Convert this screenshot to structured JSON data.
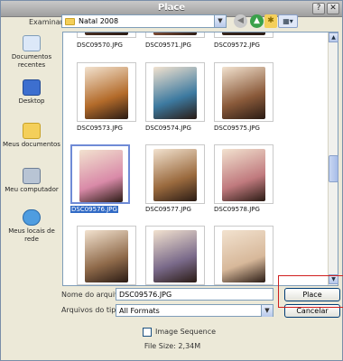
{
  "window": {
    "title": "Place"
  },
  "toolbar": {
    "lookin_label": "Examinar:",
    "lookin_value": "Natal 2008",
    "back_icon": "back-arrow-icon",
    "up_icon": "up-folder-icon",
    "newfolder_icon": "new-folder-icon",
    "views_icon": "views-menu-icon"
  },
  "places": [
    {
      "label": "Documentos recentes",
      "icon": "recent-documents-icon"
    },
    {
      "label": "Desktop",
      "icon": "desktop-icon"
    },
    {
      "label": "Meus documentos",
      "icon": "my-documents-icon"
    },
    {
      "label": "Meu computador",
      "icon": "my-computer-icon"
    },
    {
      "label": "Meus locais de rede",
      "icon": "network-places-icon"
    }
  ],
  "files": [
    {
      "name": "DSC09570.JPG",
      "color": "#5b3a2a"
    },
    {
      "name": "DSC09571.JPG",
      "color": "#a86545"
    },
    {
      "name": "DSC09572.JPG",
      "color": "#3e2a20"
    },
    {
      "name": "DSC09573.JPG",
      "color": "#b36b2a"
    },
    {
      "name": "DSC09574.JPG",
      "color": "#3d7aa0"
    },
    {
      "name": "DSC09575.JPG",
      "color": "#8a5a3a"
    },
    {
      "name": "DSC09576.JPG",
      "color": "#d98aa8",
      "selected": true
    },
    {
      "name": "DSC09577.JPG",
      "color": "#9a6a3e"
    },
    {
      "name": "DSC09578.JPG",
      "color": "#c07a7e"
    },
    {
      "name": "",
      "color": "#8f6a4a"
    },
    {
      "name": "",
      "color": "#7a6a8a"
    },
    {
      "name": "",
      "color": "#d7b89a"
    }
  ],
  "form": {
    "filename_label": "Nome do arquivo:",
    "filename_value": "DSC09576.JPG",
    "filetype_label": "Arquivos do tipo:",
    "filetype_value": "All Formats",
    "place_button": "Place",
    "cancel_button": "Cancelar",
    "image_sequence_label": "Image Sequence",
    "image_sequence_checked": false,
    "file_size": "File Size: 2,34M"
  }
}
